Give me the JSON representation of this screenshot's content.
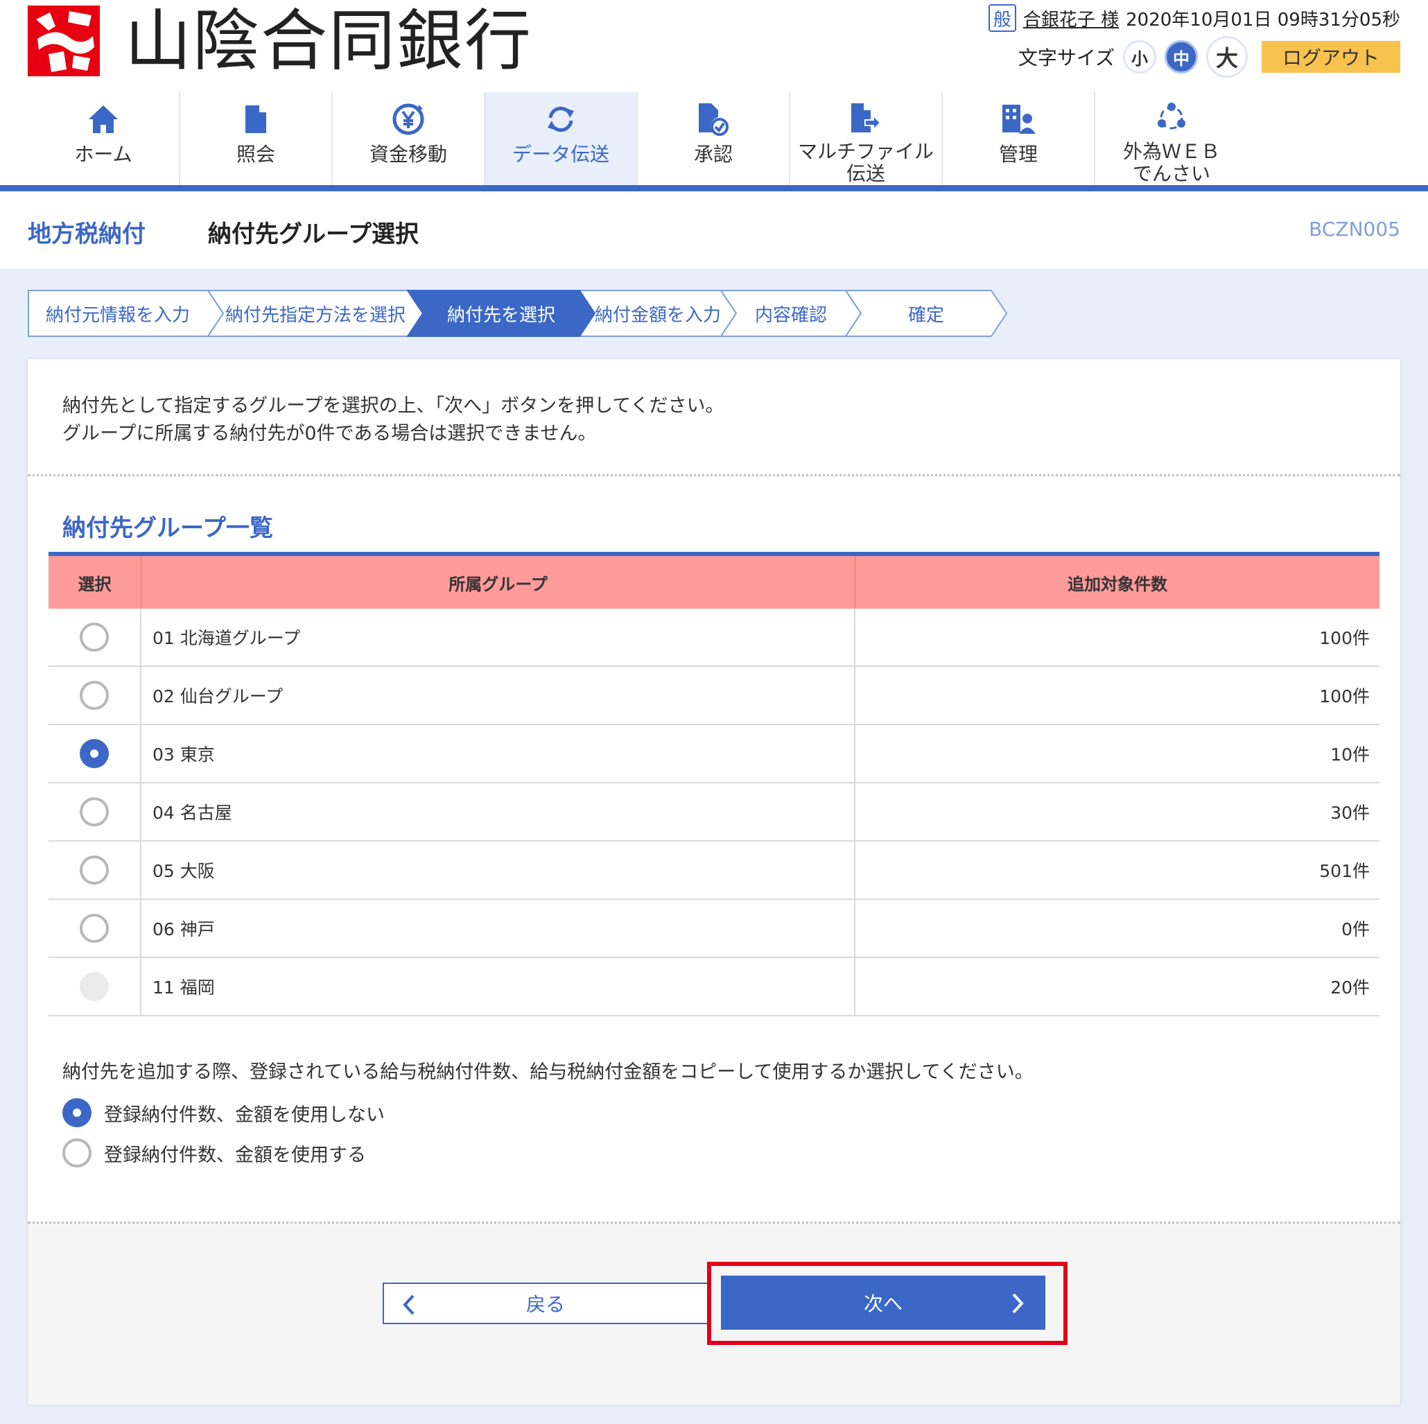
{
  "header": {
    "bank_name": "山陰合同銀行",
    "user_badge": "般",
    "user_name": "合銀花子 様",
    "datetime": "2020年10月01日 09時31分05秒",
    "font_size_label": "文字サイズ",
    "font_small": "小",
    "font_medium": "中",
    "font_large": "大",
    "logout": "ログアウト"
  },
  "nav": {
    "items": [
      {
        "label": "ホーム",
        "icon": "home-icon"
      },
      {
        "label": "照会",
        "icon": "document-icon"
      },
      {
        "label": "資金移動",
        "icon": "yen-transfer-icon"
      },
      {
        "label": "データ伝送",
        "icon": "sync-icon"
      },
      {
        "label": "承認",
        "icon": "document-check-icon"
      },
      {
        "label": "マルチファイル伝送",
        "icon": "file-send-icon"
      },
      {
        "label": "管理",
        "icon": "building-user-icon"
      },
      {
        "label": "外為ＷＥＢでんさい",
        "icon": "network-icon"
      }
    ],
    "active_index": 3
  },
  "title": {
    "section": "地方税納付",
    "page": "納付先グループ選択",
    "screen_id": "BCZN005"
  },
  "steps": {
    "items": [
      "納付元情報を入力",
      "納付先指定方法を選択",
      "納付先を選択",
      "納付金額を入力",
      "内容確認",
      "確定"
    ],
    "current_index": 2
  },
  "instructions": {
    "line1": "納付先として指定するグループを選択の上、「次へ」ボタンを押してください。",
    "line2": "グループに所属する納付先が0件である場合は選択できません。"
  },
  "group_list": {
    "title": "納付先グループ一覧",
    "headers": {
      "select": "選択",
      "group": "所属グループ",
      "count": "追加対象件数"
    },
    "rows": [
      {
        "group": "01 北海道グループ",
        "count": "100件",
        "state": "unchecked"
      },
      {
        "group": "02 仙台グループ",
        "count": "100件",
        "state": "unchecked"
      },
      {
        "group": "03 東京",
        "count": "10件",
        "state": "checked"
      },
      {
        "group": "04 名古屋",
        "count": "30件",
        "state": "unchecked"
      },
      {
        "group": "05 大阪",
        "count": "501件",
        "state": "unchecked"
      },
      {
        "group": "06 神戸",
        "count": "0件",
        "state": "unchecked"
      },
      {
        "group": "11 福岡",
        "count": "20件",
        "state": "disabled"
      }
    ]
  },
  "copy_option": {
    "note": "納付先を追加する際、登録されている給与税納付件数、給与税納付金額をコピーして使用するか選択してください。",
    "options": [
      {
        "label": "登録納付件数、金額を使用しない",
        "checked": true
      },
      {
        "label": "登録納付件数、金額を使用する",
        "checked": false
      }
    ]
  },
  "buttons": {
    "back": "戻る",
    "next": "次へ"
  },
  "colors": {
    "primary": "#3b67c6",
    "table_header": "#fd9a9a",
    "logout": "#f8c24e",
    "highlight": "#e0001a",
    "brand_red": "#e60012"
  }
}
